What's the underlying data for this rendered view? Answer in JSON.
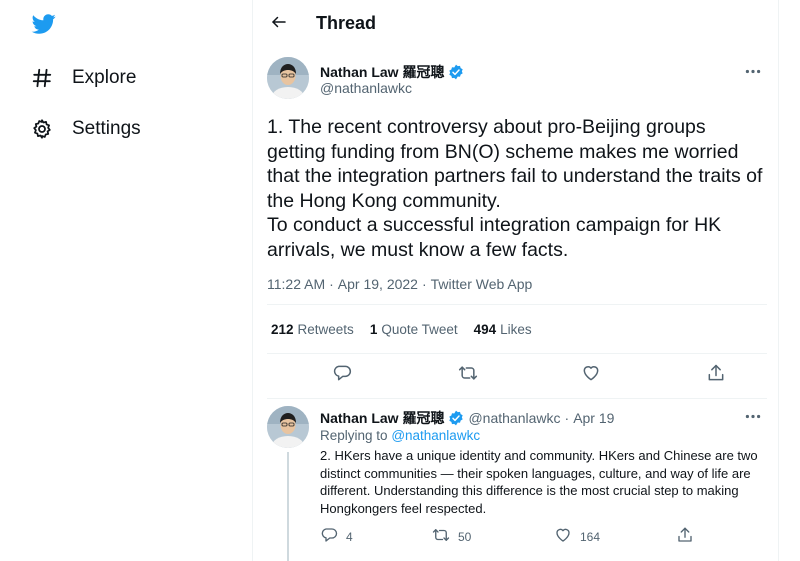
{
  "sidebar": {
    "logo_icon": "twitter-bird-icon",
    "items": [
      {
        "label": "Explore",
        "icon": "hashtag-icon"
      },
      {
        "label": "Settings",
        "icon": "gear-icon"
      }
    ]
  },
  "header": {
    "back_icon": "arrow-left-icon",
    "title": "Thread"
  },
  "main_tweet": {
    "author_name": "Nathan Law 羅冠聰",
    "handle": "@nathanlawkc",
    "text": "1. The recent controversy about pro-Beijing groups getting funding from BN(O) scheme makes me worried that the integration partners fail to understand the traits of the Hong Kong community.\nTo conduct a successful integration campaign for HK arrivals, we must know a few facts.",
    "time": "11:22 AM",
    "date": "Apr 19, 2022",
    "separator": "·",
    "source": "Twitter Web App",
    "stats": {
      "retweets_count": "212",
      "retweets_label": "Retweets",
      "quotes_count": "1",
      "quotes_label": "Quote Tweet",
      "likes_count": "494",
      "likes_label": "Likes"
    }
  },
  "reply_tweet": {
    "author_name": "Nathan Law 羅冠聰",
    "handle": "@nathanlawkc",
    "separator": "·",
    "date": "Apr 19",
    "replying_prefix": "Replying to",
    "replying_to": "@nathanlawkc",
    "text": "2. HKers have a unique identity and community. HKers and Chinese are two distinct communities — their spoken languages, culture, and way of life are different. Understanding this difference is the most crucial step to making Hongkongers feel respected.",
    "reply_count": "4",
    "retweet_count": "50",
    "like_count": "164"
  },
  "colors": {
    "accent": "#1d9bf0",
    "text": "#0f1419",
    "secondary": "#536471",
    "border": "#eff3f4"
  }
}
